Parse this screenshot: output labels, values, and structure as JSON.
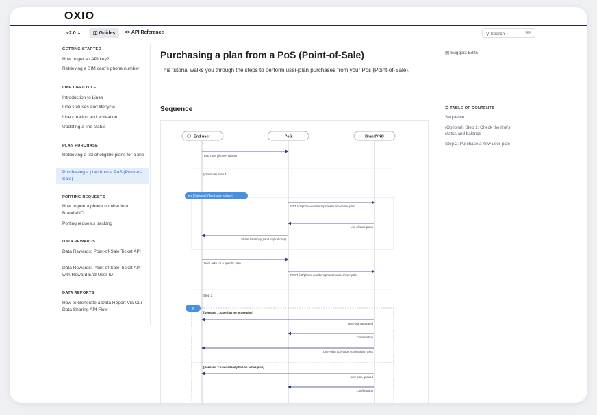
{
  "brand": {
    "logo": "OXIO"
  },
  "nav": {
    "version": "v2.0 ⌄",
    "guides": "Guides",
    "api_reference": "API Reference",
    "search_placeholder": "Search",
    "search_shortcut": "⌘K"
  },
  "sidebar": {
    "sections": [
      {
        "heading": "GETTING STARTED",
        "items": [
          "How to get an API key?",
          "Retrieving a SIM card's phone number"
        ]
      },
      {
        "heading": "LINE LIFECYCLE",
        "items": [
          "Introduction to Lines",
          "Line statuses and lifecycle",
          "Line creation and activation",
          "Updating a line status"
        ]
      },
      {
        "heading": "PLAN PURCHASE",
        "items": [
          "Retrieving a list of eligible plans for a line",
          "Purchasing a plan from a PoS (Point-of-Sale)"
        ]
      },
      {
        "heading": "PORTING REQUESTS",
        "items": [
          "How to port a phone number into BrandVNO",
          "Porting requests tracking"
        ]
      },
      {
        "heading": "DATA REWARDS",
        "items": [
          "Data Rewards: Point-of-Sale Ticket API",
          "Data Rewards: Point-of-Sale Ticket API with Reward End User ID"
        ]
      },
      {
        "heading": "DATA REPORTS",
        "items": [
          "How to Generate a Data Report Via Our Data Sharing API Flow"
        ]
      }
    ]
  },
  "main": {
    "title": "Purchasing a plan from a PoS (Point-of-Sale)",
    "intro": "This tutorial walks you through the steps to perform user-plan purchases from your Pos (Point-of-Sale).",
    "sequence_heading": "Sequence",
    "suggest_edits": "Suggest Edits"
  },
  "toc": {
    "heading": "TABLE OF CONTENTS",
    "items": [
      "Sequence",
      "(Optional) Step 1: Check the line's status and balance",
      "Step 2: Purchase a new user-plan"
    ]
  },
  "diagram": {
    "actors": [
      "End user",
      "PoS",
      "BrandVNO"
    ],
    "messages": {
      "m1": "End user phone-number",
      "step1": "(Optional) Step 1",
      "opt": "opt [(Optional) Check user balance]",
      "m2": "GET /v2/phone-numbers/phoneNumber/user-plan",
      "m3": "List of user-plans",
      "m4": "Share balance(s) and expiration(s)",
      "m5": "User asks for a specific plan",
      "m6": "POST /v2/phone-numbers/phoneNumber/user-plan",
      "step2": "Step 2",
      "alt": "alt",
      "s1": "[Scenario 1: user has no active plan]",
      "m7": "user-plan activated",
      "m8": "Confirmation",
      "m9": "User-plan activation confirmation SMS",
      "s2": "[Scenario 2: user already had an active plan]",
      "m10": "user-plan queued",
      "m11": "Confirmation"
    }
  },
  "colors": {
    "accent": "#3a6fc4",
    "arrow": "#2e3a7a",
    "topline": "#1e2757",
    "pill": "#4a90e2"
  }
}
